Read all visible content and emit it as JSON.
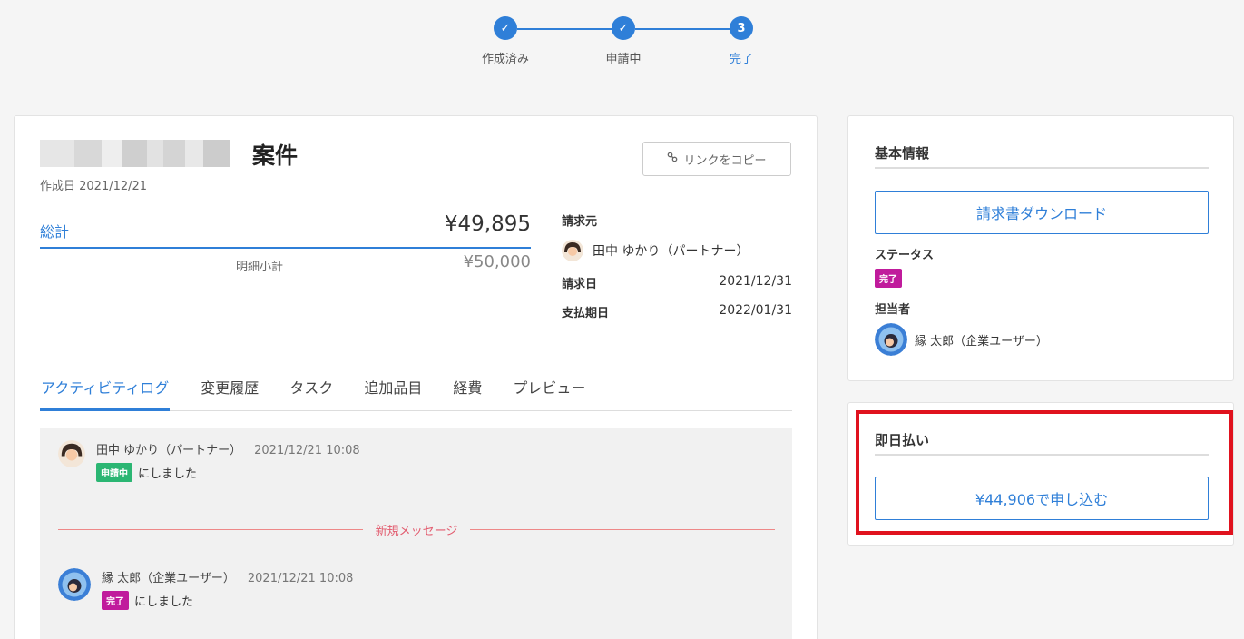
{
  "stepper": {
    "steps": [
      {
        "label": "作成済み",
        "state": "done",
        "glyph": "✓"
      },
      {
        "label": "申請中",
        "state": "done",
        "glyph": "✓"
      },
      {
        "label": "完了",
        "state": "current",
        "glyph": "3"
      }
    ]
  },
  "case": {
    "title": "案件",
    "created": "作成日 2021/12/21",
    "copy_link": "リンクをコピー",
    "total_label": "総計",
    "total_value": "¥49,895",
    "subtotal_label": "明細小計",
    "subtotal_value": "¥50,000"
  },
  "billing": {
    "from_label": "請求元",
    "from_name": "田中 ゆかり（パートナー）",
    "invoice_date_label": "請求日",
    "invoice_date": "2021/12/31",
    "due_date_label": "支払期日",
    "due_date": "2022/01/31"
  },
  "tabs": [
    "アクティビティログ",
    "変更履歴",
    "タスク",
    "追加品目",
    "経費",
    "プレビュー"
  ],
  "activity": {
    "entries": [
      {
        "author": "田中 ゆかり（パートナー）",
        "time": "2021/12/21 10:08",
        "badge": "申請中",
        "text": "にしました"
      },
      {
        "author": "縁 太郎（企業ユーザー）",
        "time": "2021/12/21 10:08",
        "badge": "完了",
        "text": "にしました"
      }
    ],
    "divider": "新規メッセージ"
  },
  "basic_info": {
    "title": "基本情報",
    "download": "請求書ダウンロード",
    "status_label": "ステータス",
    "status_badge": "完了",
    "assignee_label": "担当者",
    "assignee_name": "縁 太郎（企業ユーザー）"
  },
  "same_day_pay": {
    "title": "即日払い",
    "apply": "¥44,906で申し込む"
  },
  "colors": {
    "accent": "#2f7fd8",
    "applying": "#2bb673",
    "done": "#c01b9c",
    "highlight": "#e0121e"
  }
}
